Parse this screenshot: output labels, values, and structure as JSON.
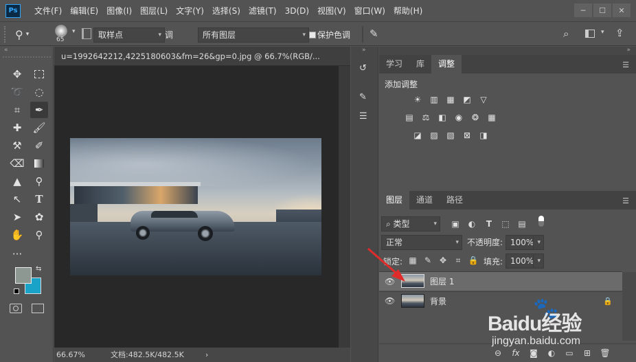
{
  "app": {
    "logo": "Ps"
  },
  "menu": [
    "文件(F)",
    "编辑(E)",
    "图像(I)",
    "图层(L)",
    "文字(Y)",
    "选择(S)",
    "滤镜(T)",
    "3D(D)",
    "视图(V)",
    "窗口(W)",
    "帮助(H)"
  ],
  "window_controls": {
    "minimize": "─",
    "maximize": "☐",
    "close": "✕"
  },
  "options": {
    "brush_size": "65",
    "sample_size": "取样点",
    "sample_partial": "调",
    "sample_layers": "所有图层",
    "protect_color": "保护色调"
  },
  "document": {
    "tab_title": "u=1992642212,4225180603&fm=26&gp=0.jpg @ 66.7%(RGB/...",
    "zoom": "66.67%",
    "doc_size": "文档:482.5K/482.5K",
    "status_arrow": "›"
  },
  "adjust_panel": {
    "tabs": [
      "学习",
      "库",
      "调整"
    ],
    "active_tab": "调整",
    "title": "添加调整"
  },
  "layers_panel": {
    "tabs": [
      "图层",
      "通道",
      "路径"
    ],
    "active_tab": "图层",
    "filter_kind": "类型",
    "blend_mode": "正常",
    "opacity_label": "不透明度:",
    "opacity": "100%",
    "lock_label": "锁定:",
    "fill_label": "填充:",
    "fill": "100%",
    "layers": [
      {
        "name": "图层 1",
        "selected": true,
        "locked": false
      },
      {
        "name": "背景",
        "selected": false,
        "locked": true
      }
    ]
  },
  "colors": {
    "foreground": "#8c9891",
    "background": "#1aa3c9",
    "accent_arrow": "#e02b2b"
  },
  "watermark": {
    "brand": "Baidu经验",
    "url": "jingyan.baidu.com"
  }
}
